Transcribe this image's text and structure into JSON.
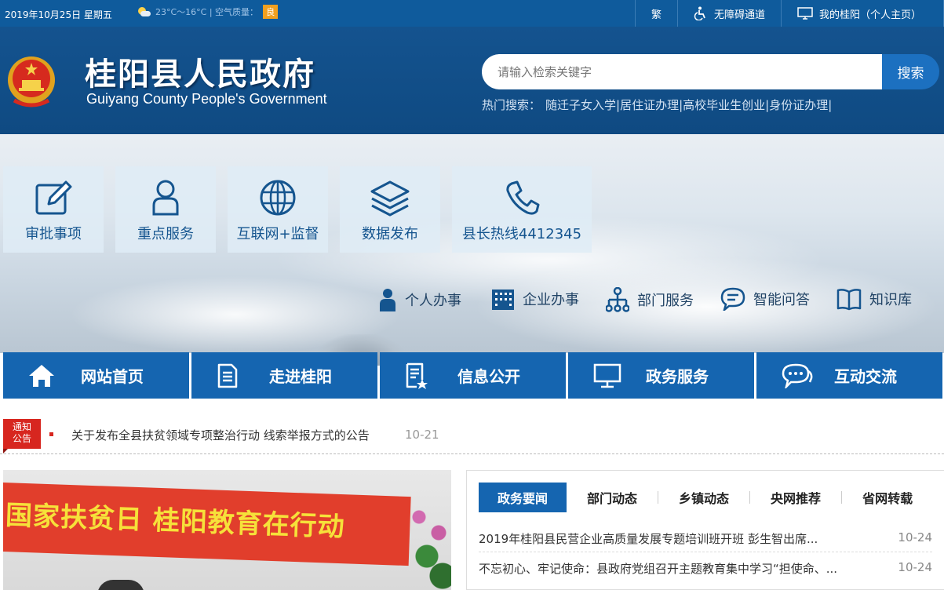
{
  "topbar": {
    "date": "2019年10月25日 星期五",
    "weather": "23°C～16°C | 空气质量：",
    "air_quality": "良",
    "traditional": "繁",
    "accessibility": "无障碍通道",
    "my_guiyang": "我的桂阳（个人主页）"
  },
  "header": {
    "title": "桂阳县人民政府",
    "subtitle": "Guiyang County People's Government",
    "search_placeholder": "请输入检索关键字",
    "search_button": "搜索",
    "hot_label": "热门搜索：",
    "hot_items": [
      "随迁子女入学|",
      "居住证办理|",
      "高校毕业生创业|",
      "身份证办理|"
    ]
  },
  "tiles": [
    {
      "label": "审批事项",
      "icon": "edit-icon"
    },
    {
      "label": "重点服务",
      "icon": "person-icon"
    },
    {
      "label": "互联网+监督",
      "icon": "globe-icon"
    },
    {
      "label": "数据发布",
      "icon": "layers-icon"
    },
    {
      "label": "县长热线4412345",
      "icon": "phone-icon"
    }
  ],
  "quick_links": [
    {
      "label": "个人办事",
      "icon": "user-icon"
    },
    {
      "label": "企业办事",
      "icon": "building-icon"
    },
    {
      "label": "部门服务",
      "icon": "org-chart-icon"
    },
    {
      "label": "智能问答",
      "icon": "chat-bubble-icon"
    },
    {
      "label": "知识库",
      "icon": "book-icon"
    }
  ],
  "nav": [
    {
      "label": "网站首页",
      "icon": "home-icon"
    },
    {
      "label": "走进桂阳",
      "icon": "document-icon"
    },
    {
      "label": "信息公开",
      "icon": "doc-star-icon"
    },
    {
      "label": "政务服务",
      "icon": "monitor-icon"
    },
    {
      "label": "互动交流",
      "icon": "chat-icon"
    }
  ],
  "notice": {
    "badge_line1": "通知",
    "badge_line2": "公告",
    "text": "关于发布全县扶贫领域专项整治行动 线索举报方式的公告",
    "date": "10-21"
  },
  "photo": {
    "banner_text": "国家扶贫日  桂阳教育在行动"
  },
  "news": {
    "tabs": [
      "政务要闻",
      "部门动态",
      "乡镇动态",
      "央网推荐",
      "省网转载"
    ],
    "items": [
      {
        "title": "2019年桂阳县民营企业高质量发展专题培训班开班 彭生智出席...",
        "date": "10-24"
      },
      {
        "title": "不忘初心、牢记使命：县政府党组召开主题教育集中学习“担使命、...",
        "date": "10-24"
      }
    ]
  },
  "colors": {
    "topbar": "#0f5b9c",
    "header": "#14538f",
    "nav": "#1565b0",
    "notice_red": "#d7261f",
    "air_badge": "#f2a01f"
  }
}
